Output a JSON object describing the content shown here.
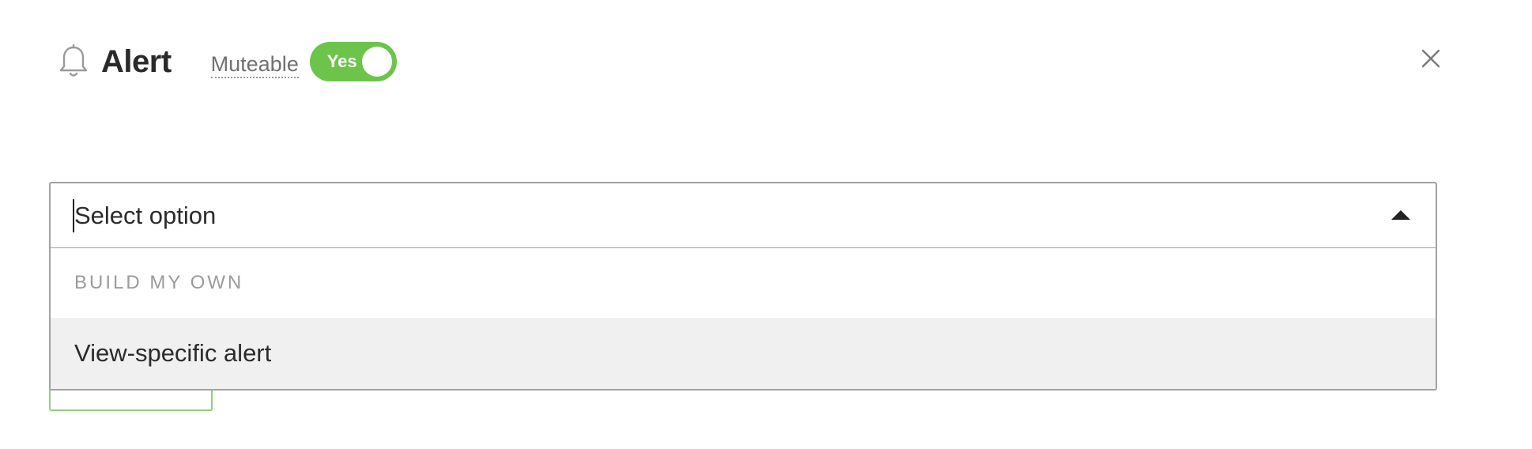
{
  "header": {
    "title": "Alert",
    "icon": "bell-icon",
    "muteable_label": "Muteable",
    "toggle": {
      "label": "Yes",
      "state": "on",
      "color": "#6cc44a"
    },
    "close_icon": "close-icon"
  },
  "select": {
    "placeholder": "Select option",
    "expanded": true,
    "caret_icon": "caret-up-icon",
    "groups": [
      {
        "header": "BUILD MY OWN",
        "options": [
          {
            "label": "View-specific alert",
            "highlighted": true
          }
        ]
      }
    ]
  },
  "colors": {
    "accent_green": "#6cc44a",
    "option_highlight": "#f0f0f0",
    "border": "#a3a3a3"
  }
}
